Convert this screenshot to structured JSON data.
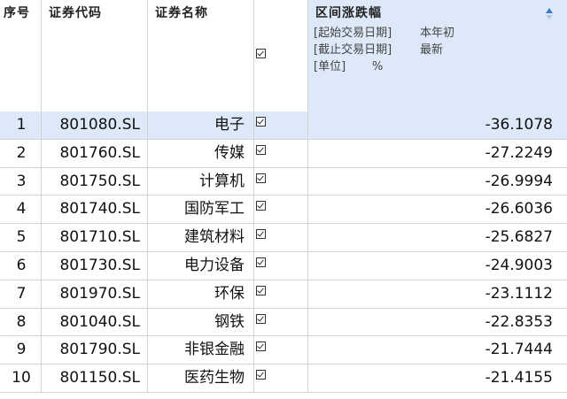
{
  "columns": {
    "index": "序号",
    "code": "证券代码",
    "name": "证券名称",
    "change": {
      "title": "区间涨跌幅",
      "params": [
        {
          "key": "[起始交易日期]",
          "value": "本年初"
        },
        {
          "key": "[截止交易日期]",
          "value": "最新"
        },
        {
          "key": "[单位]",
          "value": "%"
        }
      ]
    }
  },
  "selected_row": 1,
  "rows": [
    {
      "index": "1",
      "code": "801080.SL",
      "name": "电子",
      "checked": true,
      "change": "-36.1078"
    },
    {
      "index": "2",
      "code": "801760.SL",
      "name": "传媒",
      "checked": true,
      "change": "-27.2249"
    },
    {
      "index": "3",
      "code": "801750.SL",
      "name": "计算机",
      "checked": true,
      "change": "-26.9994"
    },
    {
      "index": "4",
      "code": "801740.SL",
      "name": "国防军工",
      "checked": true,
      "change": "-26.6036"
    },
    {
      "index": "5",
      "code": "801710.SL",
      "name": "建筑材料",
      "checked": true,
      "change": "-25.6827"
    },
    {
      "index": "6",
      "code": "801730.SL",
      "name": "电力设备",
      "checked": true,
      "change": "-24.9003"
    },
    {
      "index": "7",
      "code": "801970.SL",
      "name": "环保",
      "checked": true,
      "change": "-23.1112"
    },
    {
      "index": "8",
      "code": "801040.SL",
      "name": "钢铁",
      "checked": true,
      "change": "-22.8353"
    },
    {
      "index": "9",
      "code": "801790.SL",
      "name": "非银金融",
      "checked": true,
      "change": "-21.7444"
    },
    {
      "index": "10",
      "code": "801150.SL",
      "name": "医药生物",
      "checked": true,
      "change": "-21.4155"
    }
  ]
}
